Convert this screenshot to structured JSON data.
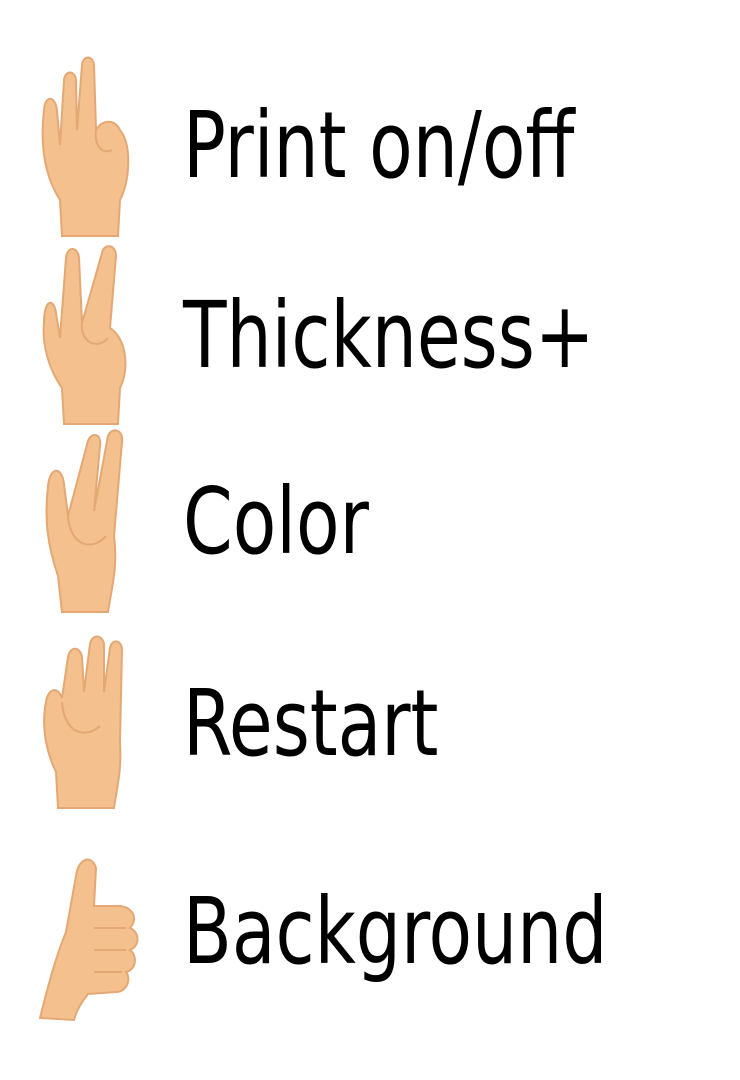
{
  "gestures": [
    {
      "label": "Print on/off",
      "icon": "hand-three-fingers-icon"
    },
    {
      "label": "Thickness+",
      "icon": "hand-two-fingers-icon"
    },
    {
      "label": "Color",
      "icon": "hand-two-fingers-tucked-icon"
    },
    {
      "label": "Restart",
      "icon": "hand-three-fingers-up-icon"
    },
    {
      "label": "Background",
      "icon": "thumbs-up-icon"
    }
  ],
  "colors": {
    "skin": "#f3c08e",
    "skin_shadow": "#e3a874",
    "text": "#000000",
    "background": "#ffffff"
  }
}
